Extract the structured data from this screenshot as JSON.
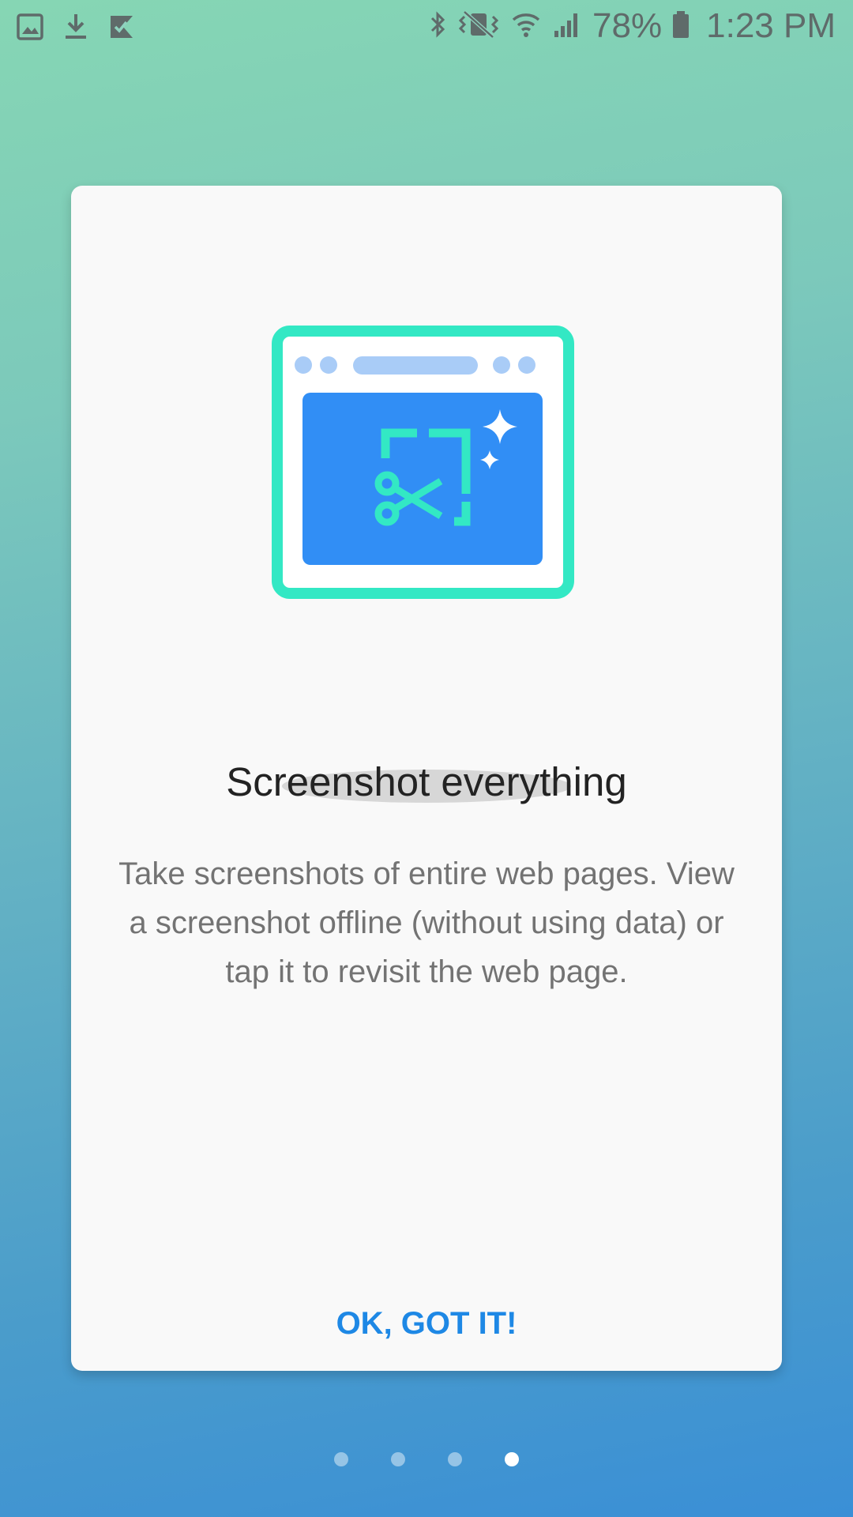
{
  "status_bar": {
    "notification_icons": [
      "gallery-icon",
      "download-icon",
      "tasks-check-icon"
    ],
    "system_icons": [
      "bluetooth-icon",
      "vibrate-mute-icon",
      "wifi-icon",
      "cellular-signal-icon"
    ],
    "battery": "78%",
    "time": "1:23 PM"
  },
  "card": {
    "illustration": "browser-screenshot-scissors-illustration",
    "title": "Screenshot everything",
    "body": "Take screenshots of entire web pages. View a screenshot offline (without using data) or tap it to revisit the web page.",
    "button_label": "OK, GOT IT!"
  },
  "pager": {
    "total": 4,
    "active_index": 3
  },
  "colors": {
    "accent": "#1e88e5",
    "illustration_frame": "#33e8c4",
    "illustration_screen": "#318ef5",
    "illustration_bar": "#a9ccf7"
  }
}
